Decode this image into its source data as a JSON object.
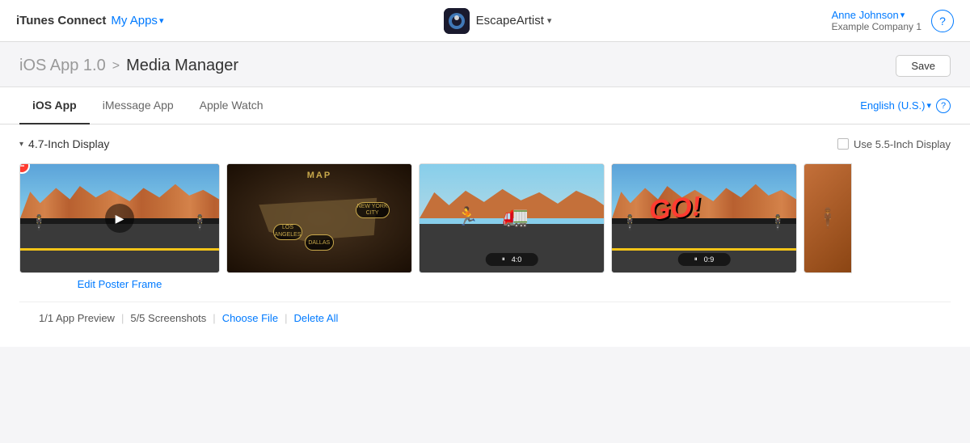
{
  "topNav": {
    "brand": "iTunes Connect",
    "myApps": "My Apps",
    "chevron": "▾",
    "appName": "EscapeArtist",
    "user": {
      "name": "Anne Johnson",
      "company": "Example Company 1"
    },
    "helpLabel": "?"
  },
  "breadcrumb": {
    "parent": "iOS App 1.0",
    "separator": ">",
    "current": "Media Manager",
    "saveLabel": "Save"
  },
  "tabs": [
    {
      "id": "ios-app",
      "label": "iOS App",
      "active": true
    },
    {
      "id": "imessage-app",
      "label": "iMessage App",
      "active": false
    },
    {
      "id": "apple-watch",
      "label": "Apple Watch",
      "active": false
    }
  ],
  "languageSelector": {
    "label": "English (U.S.)",
    "chevron": "▾",
    "helpLabel": "?"
  },
  "displaySection": {
    "title": "4.7-Inch Display",
    "use55Label": "Use 5.5-Inch Display"
  },
  "bottomBar": {
    "previewCount": "1/1 App Preview",
    "divider1": "|",
    "screenshotCount": "5/5 Screenshots",
    "divider2": "|",
    "chooseFile": "Choose File",
    "divider3": "|",
    "deleteAll": "Delete All"
  },
  "posterFrameLabel": "Edit Poster Frame",
  "screenshots": [
    {
      "type": "video",
      "hasPoster": true
    },
    {
      "type": "map"
    },
    {
      "type": "chase",
      "hasControls": true
    },
    {
      "type": "go",
      "hasControls": true
    },
    {
      "type": "partial"
    }
  ]
}
